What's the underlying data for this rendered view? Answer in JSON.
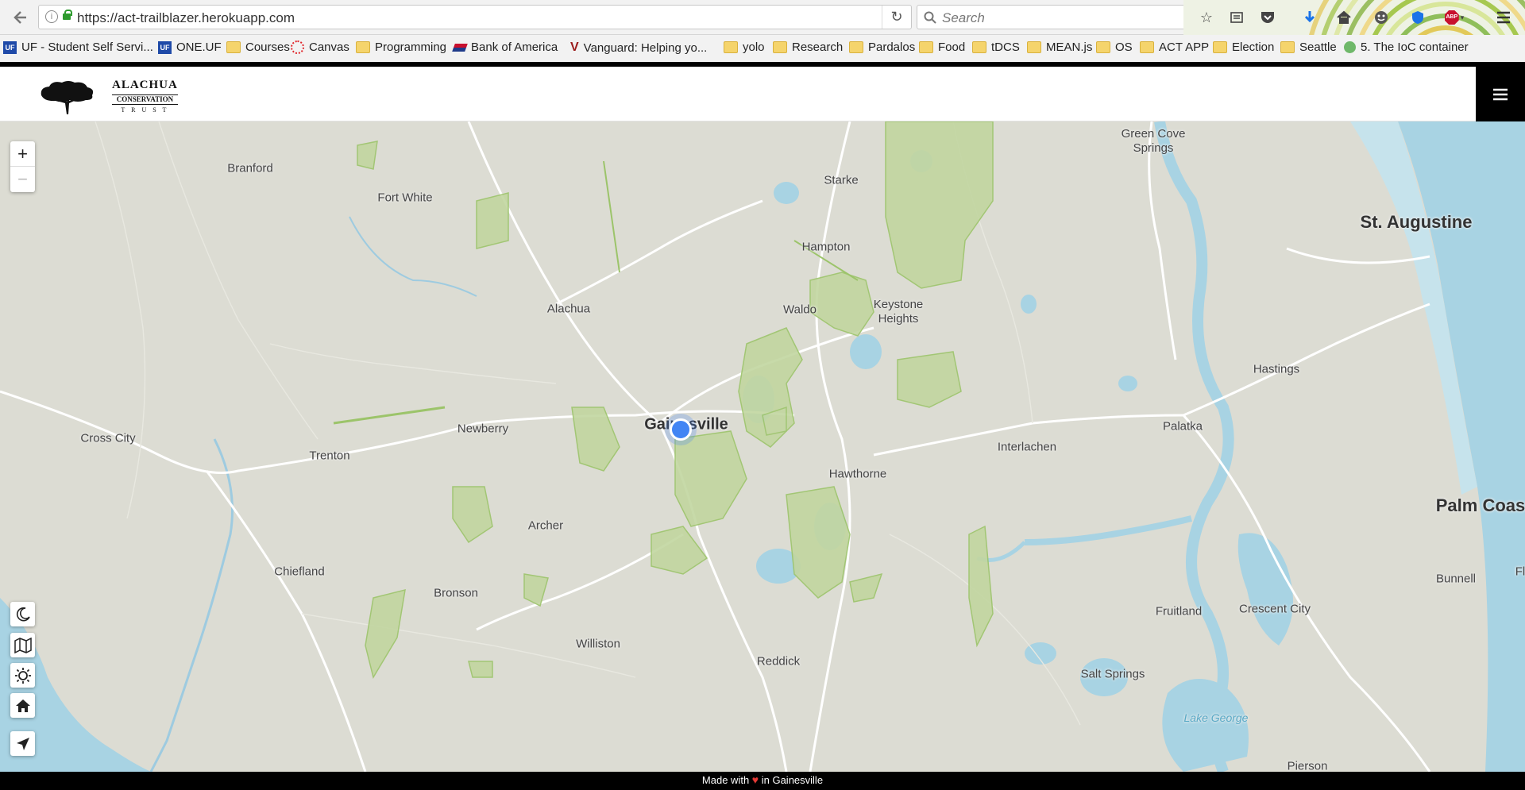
{
  "browser": {
    "url": "https://act-trailblazer.herokuapp.com",
    "search_placeholder": "Search",
    "bookmarks": [
      {
        "label": "UF - Student Self Servi..."
      },
      {
        "label": "ONE.UF"
      },
      {
        "label": "Courses"
      },
      {
        "label": "Canvas"
      },
      {
        "label": "Programming"
      },
      {
        "label": "Bank of America"
      },
      {
        "label": "Vanguard: Helping yo..."
      },
      {
        "label": "yolo"
      },
      {
        "label": "Research"
      },
      {
        "label": "Pardalos"
      },
      {
        "label": "Food"
      },
      {
        "label": "tDCS"
      },
      {
        "label": "MEAN.js"
      },
      {
        "label": "OS"
      },
      {
        "label": "ACT APP"
      },
      {
        "label": "Election"
      },
      {
        "label": "Seattle"
      },
      {
        "label": "5. The IoC container"
      }
    ],
    "abp_badge": "ABP"
  },
  "header": {
    "logo_line1": "ALACHUA",
    "logo_line2": "CONSERVATION",
    "logo_line3": "T R U S T"
  },
  "map": {
    "zoom_in": "+",
    "zoom_out": "−",
    "places": [
      {
        "name": "Branford"
      },
      {
        "name": "Fort White"
      },
      {
        "name": "Starke"
      },
      {
        "name": "Green Cove Springs"
      },
      {
        "name": "St. Augustine"
      },
      {
        "name": "Hampton"
      },
      {
        "name": "Alachua"
      },
      {
        "name": "Waldo"
      },
      {
        "name": "Keystone Heights"
      },
      {
        "name": "Hastings"
      },
      {
        "name": "Cross City"
      },
      {
        "name": "Newberry"
      },
      {
        "name": "Gainesville"
      },
      {
        "name": "Palatka"
      },
      {
        "name": "Trenton"
      },
      {
        "name": "Interlachen"
      },
      {
        "name": "Hawthorne"
      },
      {
        "name": "Palm Coas"
      },
      {
        "name": "Archer"
      },
      {
        "name": "Chiefland"
      },
      {
        "name": "Bronson"
      },
      {
        "name": "Bunnell"
      },
      {
        "name": "Fruitland"
      },
      {
        "name": "Crescent City"
      },
      {
        "name": "Williston"
      },
      {
        "name": "Reddick"
      },
      {
        "name": "Salt Springs"
      },
      {
        "name": "Lake George"
      },
      {
        "name": "Pierson"
      },
      {
        "name": "Fl"
      }
    ]
  },
  "footer": {
    "prefix": "Made with",
    "suffix": "in Gainesville"
  },
  "colors": {
    "land": "#dcdcd3",
    "water": "#a8d3e3",
    "park": "#c2d6a0",
    "park_border": "#9cc46a",
    "road": "#ffffff",
    "accent": "#4285f4"
  }
}
